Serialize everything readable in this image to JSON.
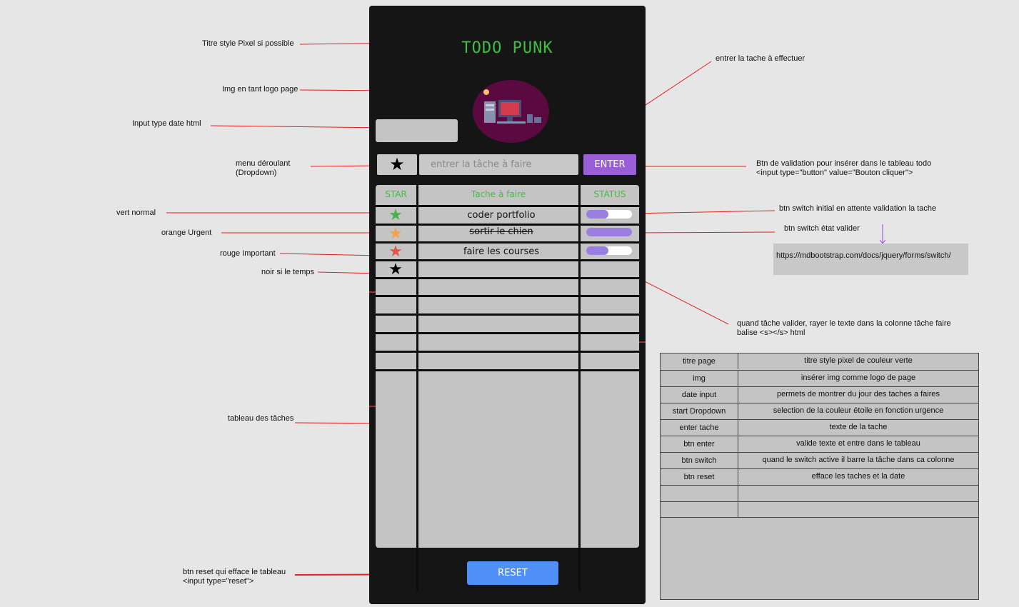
{
  "app": {
    "title": "TODO PUNK",
    "date_placeholder": "",
    "star_dropdown_icon": "★",
    "task_placeholder": "entrer la tâche à faire",
    "enter_label": "ENTER",
    "reset_label": "RESET",
    "table": {
      "headers": [
        "STAR",
        "Tache à faire",
        "STATUS"
      ],
      "rows": [
        {
          "star": "★",
          "star_color": "#46b34a",
          "task": "coder portfolio",
          "switch": "off",
          "done": false
        },
        {
          "star": "★",
          "star_color": "#f4a14a",
          "task": "sortir le chien",
          "switch": "on",
          "done": true
        },
        {
          "star": "★",
          "star_color": "#e5534b",
          "task": "faire les courses",
          "switch": "off",
          "done": false
        },
        {
          "star": "★",
          "star_color": "#000000",
          "task": "",
          "switch": "",
          "done": false
        }
      ]
    }
  },
  "annotations": {
    "title_style": "Titre style Pixel si possible",
    "img_logo": "Img en tant logo page",
    "input_date": "Input type date html",
    "dropdown_1": "menu déroulant",
    "dropdown_2": "(Dropdown)",
    "green": "vert normal",
    "orange": "orange Urgent",
    "red": "rouge Important",
    "black": "noir si le temps",
    "task_table": "tableau des tâches",
    "reset_1": "btn reset qui efface le tableau",
    "reset_2": "<input type=\"reset\">",
    "enter_task": "entrer la tache à effectuer",
    "btn_validate_1": "Btn de validation pour insérer dans le tableau todo",
    "btn_validate_2": "<input type=\"button\" value=\"Bouton cliquer\">",
    "switch_initial": "btn switch initial en attente validation la tache",
    "switch_valid": "btn switch état valider",
    "url": "https://mdbootstrap.com/docs/jquery/forms/switch/",
    "strike_1": "quand tâche valider, rayer le texte dans la colonne tâche faire",
    "strike_2": "balise <s></s> html"
  },
  "legend": {
    "rows": [
      {
        "key": "titre page",
        "value": "titre style pixel de couleur verte"
      },
      {
        "key": "img",
        "value": "insérer img comme logo de page"
      },
      {
        "key": "date input",
        "value": "permets de montrer du jour des taches a faires"
      },
      {
        "key": "start Dropdown",
        "value": "selection de la couleur étoile en fonction urgence"
      },
      {
        "key": "enter tache",
        "value": "texte de la tache"
      },
      {
        "key": "btn enter",
        "value": "valide texte et entre dans le tableau"
      },
      {
        "key": "btn switch",
        "value": "quand le switch active il barre la tâche dans ca colonne"
      },
      {
        "key": "btn reset",
        "value": "efface les taches et la date"
      },
      {
        "key": "",
        "value": ""
      },
      {
        "key": "",
        "value": ""
      }
    ]
  },
  "colors": {
    "title_green": "#3fbf3f",
    "enter_purple": "#9a5fd8",
    "reset_blue": "#4f8ff7",
    "switch_purple": "#9a7fe0",
    "annotation_red": "#e0201e"
  }
}
